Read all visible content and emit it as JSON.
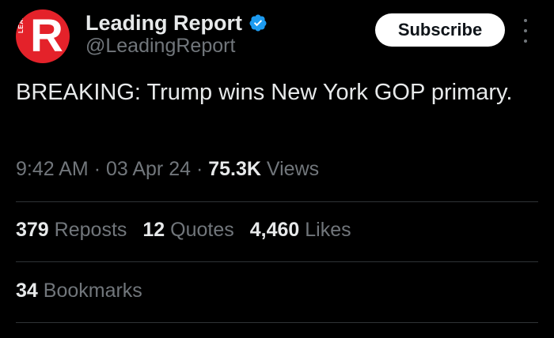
{
  "author": {
    "display_name": "Leading Report",
    "handle": "@LeadingReport",
    "avatar_letter": "R",
    "avatar_vertical_text": "LEADING",
    "verified": true,
    "avatar_color": "#e4222a",
    "verified_color": "#1d9bf0"
  },
  "header": {
    "subscribe_label": "Subscribe",
    "more_icon": "more-vertical-icon"
  },
  "tweet": {
    "text": "BREAKING: Trump wins New York GOP primary.",
    "time": "9:42 AM",
    "sep1": "·",
    "date": "03 Apr 24",
    "sep2": "·",
    "views_count": "75.3K",
    "views_label": "Views"
  },
  "stats": {
    "reposts_count": "379",
    "reposts_label": "Reposts",
    "quotes_count": "12",
    "quotes_label": "Quotes",
    "likes_count": "4,460",
    "likes_label": "Likes",
    "bookmarks_count": "34",
    "bookmarks_label": "Bookmarks"
  },
  "colors": {
    "background": "#000000",
    "text_primary": "#e7e9ea",
    "text_secondary": "#71767b",
    "divider": "#2f3336"
  }
}
